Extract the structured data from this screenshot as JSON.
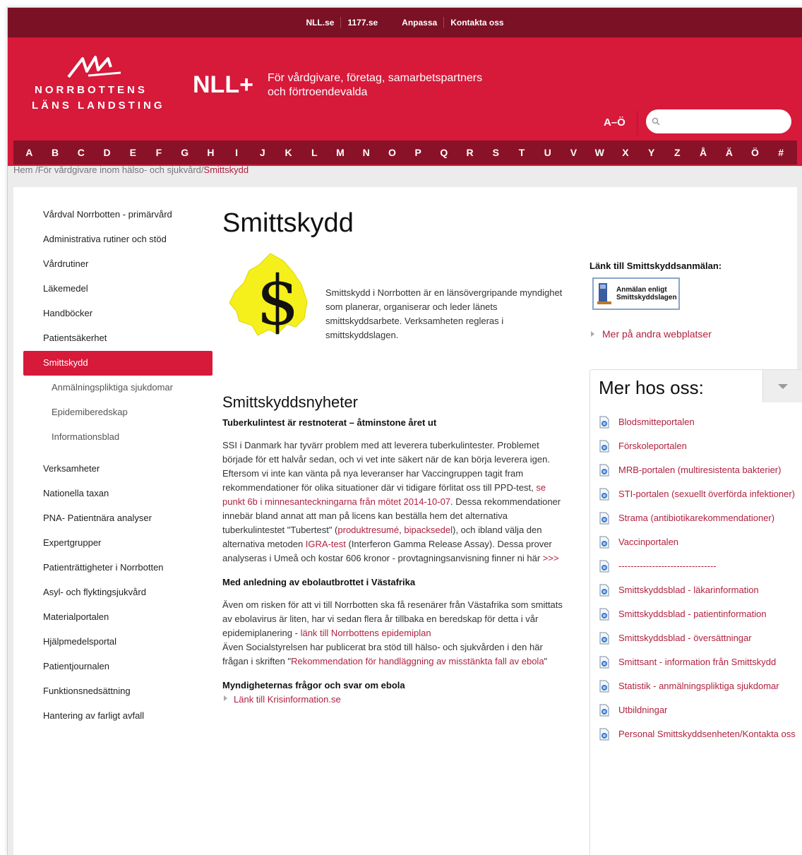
{
  "topnav": [
    "NLL.se",
    "1177.se",
    "Anpassa",
    "Kontakta oss"
  ],
  "logo": {
    "line1": "NORRBOTTENS",
    "line2": "LÄNS LANDSTING"
  },
  "brand": "NLL+",
  "tagline": "För vårdgivare, företag, samarbetspartners och förtroendevalda",
  "ao_label": "A–Ö",
  "search": {
    "placeholder": ""
  },
  "alphabet": [
    "A",
    "B",
    "C",
    "D",
    "E",
    "F",
    "G",
    "H",
    "I",
    "J",
    "K",
    "L",
    "M",
    "N",
    "O",
    "P",
    "Q",
    "R",
    "S",
    "T",
    "U",
    "V",
    "W",
    "X",
    "Y",
    "Z",
    "Å",
    "Ä",
    "Ö",
    "#"
  ],
  "breadcrumb": {
    "home": "Hem",
    "parent": "För vårdgivare inom hälso- och sjukvård",
    "current": "Smittskydd"
  },
  "sidenav": [
    {
      "label": "Vårdval Norrbotten - primärvård"
    },
    {
      "label": "Administrativa rutiner och stöd"
    },
    {
      "label": "Vårdrutiner"
    },
    {
      "label": "Läkemedel"
    },
    {
      "label": "Handböcker"
    },
    {
      "label": "Patientsäkerhet"
    },
    {
      "label": "Smittskydd"
    },
    {
      "label": "Anmälningspliktiga sjukdomar"
    },
    {
      "label": "Epidemiberedskap"
    },
    {
      "label": "Informationsblad"
    },
    {
      "label": "Verksamheter"
    },
    {
      "label": "Nationella taxan"
    },
    {
      "label": "PNA- Patientnära analyser"
    },
    {
      "label": "Expertgrupper"
    },
    {
      "label": "Patienträttigheter i Norrbotten"
    },
    {
      "label": "Asyl- och flyktingsjukvård"
    },
    {
      "label": "Materialportalen"
    },
    {
      "label": "Hjälpmedelsportal"
    },
    {
      "label": "Patientjournalen"
    },
    {
      "label": "Funktionsnedsättning"
    },
    {
      "label": "Hantering av farligt avfall"
    }
  ],
  "page": {
    "title": "Smittskydd",
    "intro": "Smittskydd i Norrbotten är en länsövergripande myndighet som planerar, organiserar och leder länets smittskyddsarbete. Verksamheten regleras i smittskyddslagen.",
    "news_title": "Smittskyddsnyheter"
  },
  "articles": {
    "a1": {
      "title": "Tuberkulintest är restnoterat – åtminstone året ut",
      "text1": "SSI i Danmark har tyvärr problem med att leverera tuberkulintester. Problemet började för ett halvår sedan, och vi vet inte säkert när de kan börja leverera igen. Eftersom vi inte kan vänta på nya leveranser har Vaccingruppen tagit fram rekommendationer för olika situationer där vi tidigare förlitat oss till PPD-test,",
      "link1": "se punkt 6b i minnesanteckningarna från mötet 2014-10-07",
      "text2": ". Dessa rekommendationer innebär bland annat att man på licens kan beställa hem det alternativa tuberkulintestet \"Tubertest\" (",
      "link2": "produktresumé",
      "text3": ", ",
      "link3": "bipacksedel",
      "text4": "), och ibland välja den alternativa metoden ",
      "link4": "IGRA-test",
      "text5": " (Interferon Gamma Release Assay). Dessa prover analyseras i Umeå och kostar 606 kronor - provtagningsanvisning finner ni här ",
      "link5": ">>>"
    },
    "a2": {
      "title": "Med anledning av ebolautbrottet i Västafrika",
      "text1": "Även om risken för att vi till Norrbotten ska få resenärer från Västafrika som smittats av ebolavirus är liten, har vi sedan flera år tillbaka en beredskap för detta i vår epidemiplanering - ",
      "link1": "länk till Norrbottens epidemiplan",
      "text2": "Även Socialstyrelsen har publicerat bra stöd till hälso- och sjukvården i den här frågan i skriften \"",
      "link2": "Rekommendation för handläggning av misstänkta fall av ebola",
      "text3": "\""
    },
    "a3": {
      "title": "Myndigheternas frågor och svar om ebola",
      "link1": "Länk till Krisinformation.se"
    }
  },
  "right": {
    "anm_label": "Länk till Smittskyddsanmälan:",
    "anm_btn_line1": "Anmälan enligt",
    "anm_btn_line2": "Smittskyddslagen",
    "more_web": "Mer på andra webplatser",
    "merbox_title": "Mer hos oss:",
    "links": [
      "Blodsmitteportalen",
      "Förskoleportalen",
      "MRB-portalen (multiresistenta bakterier)",
      "STI-portalen (sexuellt överförda infektioner)",
      "Strama (antibiotikarekommendationer)",
      "Vaccinportalen",
      "--------------------------------",
      "Smittskyddsblad - läkarinformation",
      "Smittskyddsblad - patientinformation",
      "Smittskyddsblad - översättningar",
      "Smittsant - information från Smittskydd",
      "Statistik - anmälningspliktiga sjukdomar",
      "Utbildningar",
      "Personal Smittskyddsenheten/Kontakta oss"
    ]
  },
  "colors": {
    "topbar": "#7a1124",
    "header": "#d7193a",
    "alphabar": "#8a1228",
    "link": "#b0213f",
    "emblem": "#f5ef1c"
  }
}
